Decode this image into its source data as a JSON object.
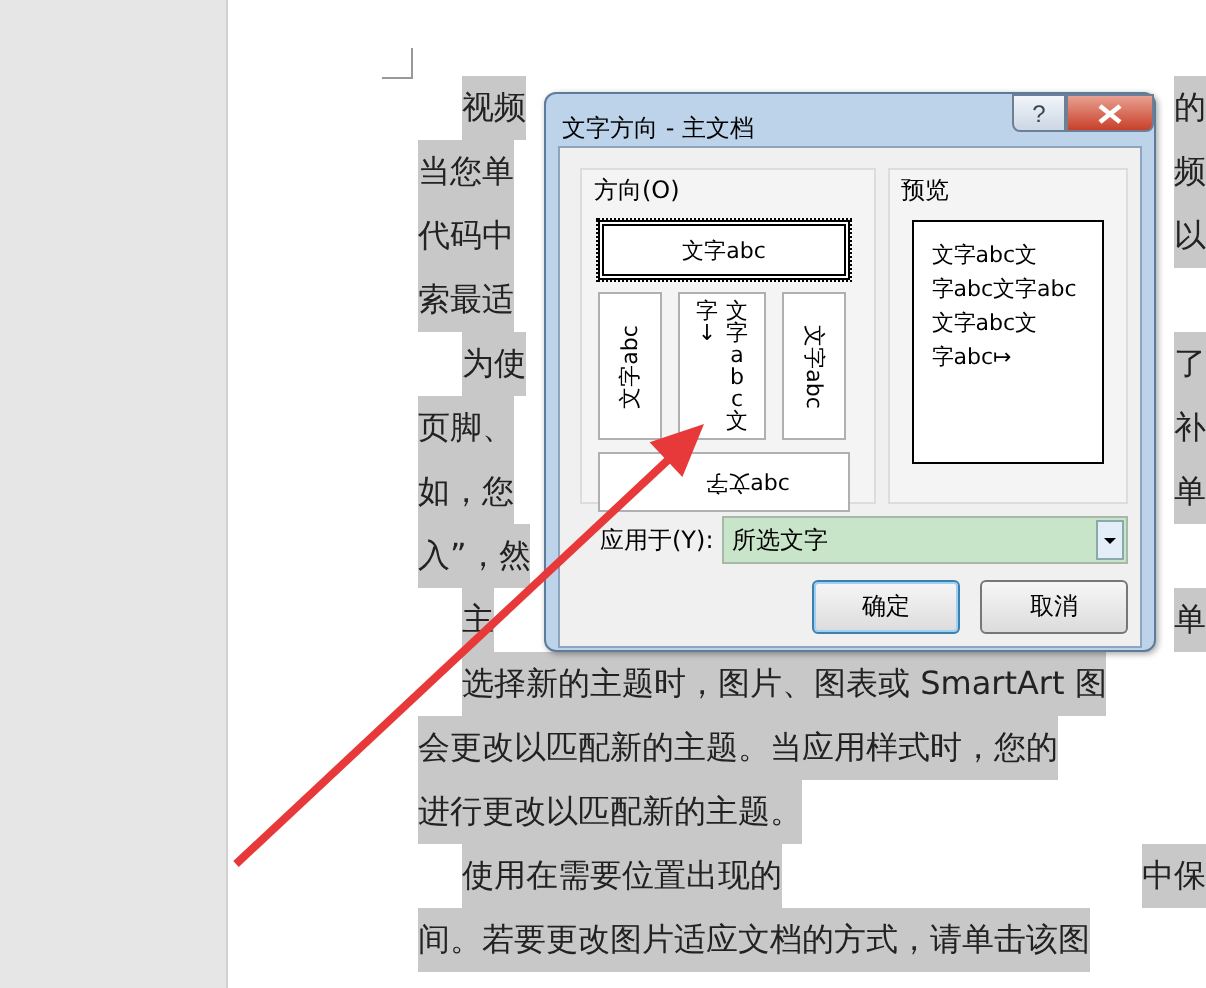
{
  "document": {
    "lines": [
      {
        "indent": true,
        "left": "视频",
        "right": "的"
      },
      {
        "indent": false,
        "left": "当您单",
        "right": "频"
      },
      {
        "indent": false,
        "left": "代码中",
        "right": "以"
      },
      {
        "indent": false,
        "left": "索最适"
      },
      {
        "indent": true,
        "left": "为使",
        "right": "了"
      },
      {
        "indent": false,
        "left": "页脚、",
        "right": "补"
      },
      {
        "indent": false,
        "left": "如，您",
        "right": "单"
      },
      {
        "indent": false,
        "left": "入”，然"
      },
      {
        "indent": true,
        "left": "主",
        "right": "单"
      },
      {
        "indent": true,
        "left": "选择新的主题时，图片、图表或 SmartArt 图"
      },
      {
        "indent": false,
        "left": "会更改以匹配新的主题。当应用样式时，您的"
      },
      {
        "indent": false,
        "left": "进行更改以匹配新的主题。"
      },
      {
        "indent": true,
        "left": "使用在需要位置出现的",
        "right": "中保"
      },
      {
        "indent": false,
        "left": "间。若要更改图片适应文档的方式，请单击该图"
      }
    ]
  },
  "dialog": {
    "title": "文字方向 - 主文档",
    "help": "?",
    "direction": {
      "label": "方向(O)",
      "options": [
        {
          "kind": "horizontal",
          "text": "文字abc",
          "selected": true
        },
        {
          "kind": "rotate-left",
          "text": "文字abc",
          "selected": false
        },
        {
          "kind": "stacked",
          "text": "文字abc文",
          "second": "字↓",
          "selected": false
        },
        {
          "kind": "rotate-right",
          "text": "文字abc",
          "selected": false
        },
        {
          "kind": "rotated-cjk",
          "rotated": "文字",
          "text": "abc",
          "selected": false
        }
      ]
    },
    "preview": {
      "label": "预览",
      "lines": [
        "文字abc文",
        "字abc文字abc",
        "文字abc文",
        "字abc↦"
      ]
    },
    "apply_to": {
      "label": "应用于(Y):",
      "value": "所选文字"
    },
    "buttons": [
      "确定",
      "取消"
    ]
  }
}
